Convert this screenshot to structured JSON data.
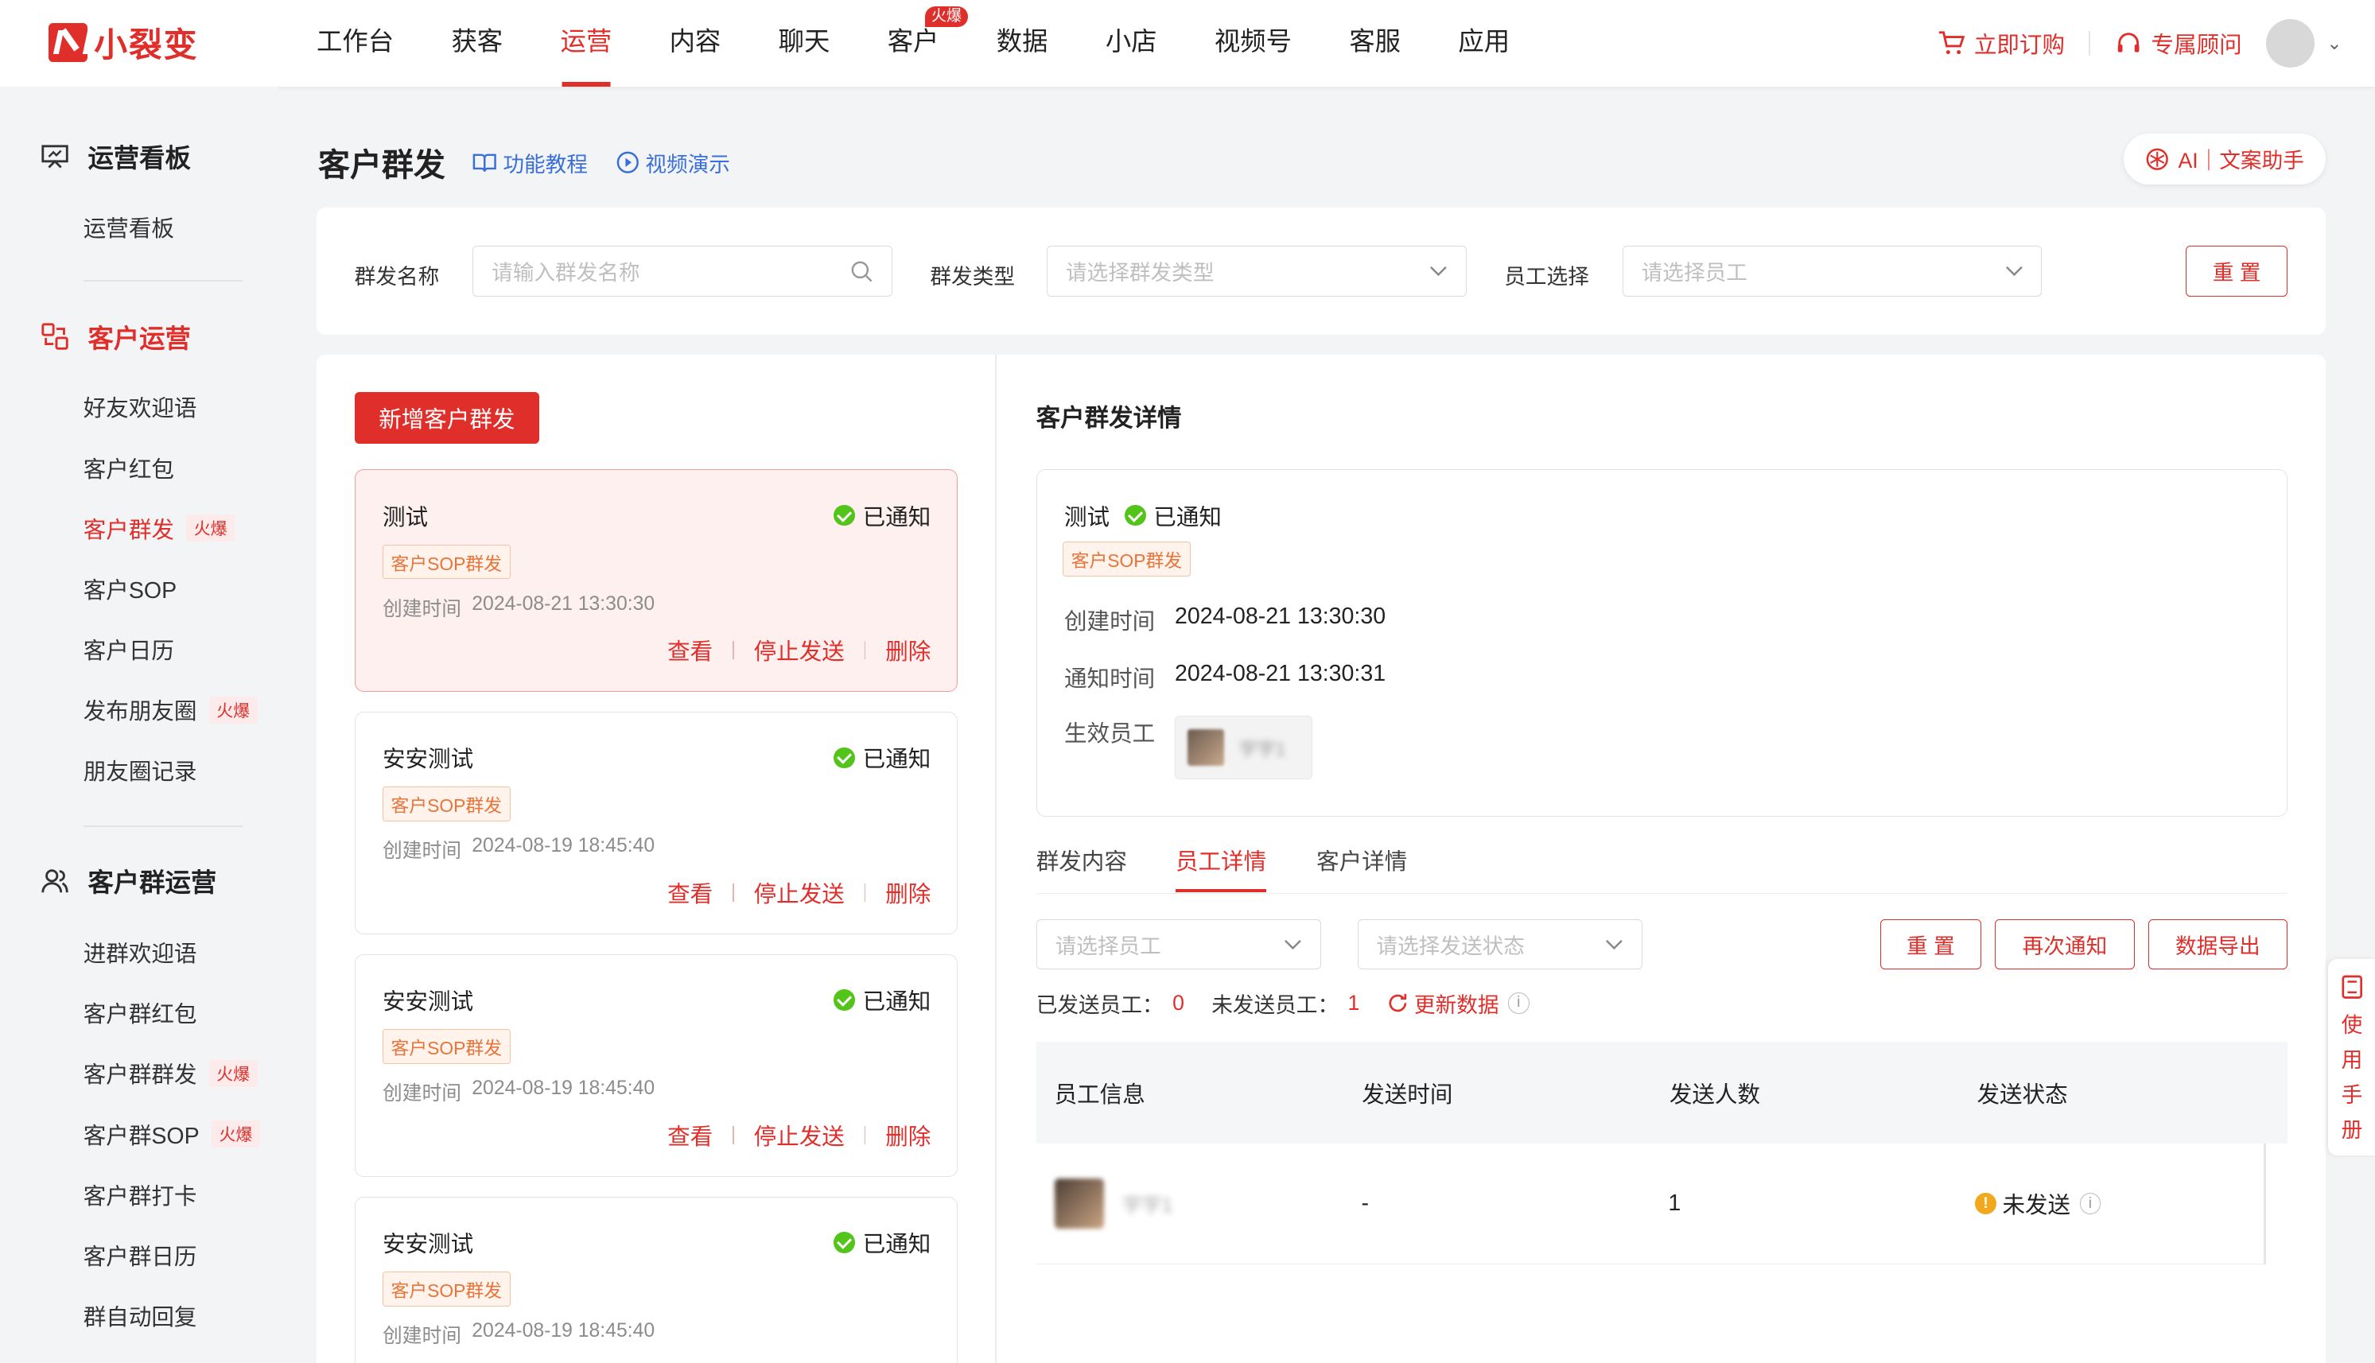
{
  "brand": {
    "name": "小裂变",
    "color": "#e02f2b"
  },
  "nav": {
    "items": [
      "工作台",
      "获客",
      "运营",
      "内容",
      "聊天",
      "客户",
      "数据",
      "小店",
      "视频号",
      "客服",
      "应用"
    ],
    "active": "运营",
    "hot_badge": "火爆"
  },
  "top_right": {
    "order": "立即订购",
    "advisor": "专属顾问"
  },
  "sidebar": {
    "group1": {
      "title": "运营看板",
      "items": [
        "运营看板"
      ]
    },
    "group2": {
      "title": "客户运营",
      "items": [
        "好友欢迎语",
        "客户红包",
        "客户群发",
        "客户SOP",
        "客户日历",
        "发布朋友圈",
        "朋友圈记录"
      ]
    },
    "group3": {
      "title": "客户群运营",
      "items": [
        "进群欢迎语",
        "客户群红包",
        "客户群群发",
        "客户群SOP",
        "客户群打卡",
        "客户群日历",
        "群自动回复"
      ]
    },
    "hot_label": "火爆"
  },
  "header": {
    "title": "客户群发",
    "tutorial": "功能教程",
    "video": "视频演示",
    "ai": "AI｜文案助手"
  },
  "filters": {
    "name_label": "群发名称",
    "name_placeholder": "请输入群发名称",
    "type_label": "群发类型",
    "type_placeholder": "请选择群发类型",
    "staff_label": "员工选择",
    "staff_placeholder": "请选择员工",
    "reset": "重 置"
  },
  "list": {
    "add_button": "新增客户群发",
    "time_label": "创建时间",
    "actions": {
      "view": "查看",
      "stop": "停止发送",
      "delete": "删除"
    },
    "tasks": [
      {
        "name": "测试",
        "status": "已通知",
        "tag": "客户SOP群发",
        "time": "2024-08-21 13:30:30"
      },
      {
        "name": "安安测试",
        "status": "已通知",
        "tag": "客户SOP群发",
        "time": "2024-08-19 18:45:40"
      },
      {
        "name": "安安测试",
        "status": "已通知",
        "tag": "客户SOP群发",
        "time": "2024-08-19 18:45:40"
      },
      {
        "name": "安安测试",
        "status": "已通知",
        "tag": "客户SOP群发",
        "time": "2024-08-19 18:45:40"
      }
    ]
  },
  "detail": {
    "title": "客户群发详情",
    "name": "测试",
    "status": "已通知",
    "tag": "客户SOP群发",
    "created_label": "创建时间",
    "created": "2024-08-21 13:30:30",
    "notified_label": "通知时间",
    "notified": "2024-08-21 13:30:31",
    "staff_label": "生效员工",
    "staff_name": "宇宇1",
    "tabs": [
      "群发内容",
      "员工详情",
      "客户详情"
    ],
    "active_tab": "员工详情",
    "staff_select_placeholder": "请选择员工",
    "status_select_placeholder": "请选择发送状态",
    "btn_reset": "重 置",
    "btn_renotify": "再次通知",
    "btn_export": "数据导出",
    "sent_label": "已发送员工：",
    "sent_count": "0",
    "unsent_label": "未发送员工：",
    "unsent_count": "1",
    "refresh": "更新数据",
    "table": {
      "headers": [
        "员工信息",
        "发送时间",
        "发送人数",
        "发送状态"
      ],
      "rows": [
        {
          "name": "宇宇1",
          "time": "-",
          "count": "1",
          "status": "未发送"
        }
      ]
    }
  },
  "manual": "使用手册"
}
